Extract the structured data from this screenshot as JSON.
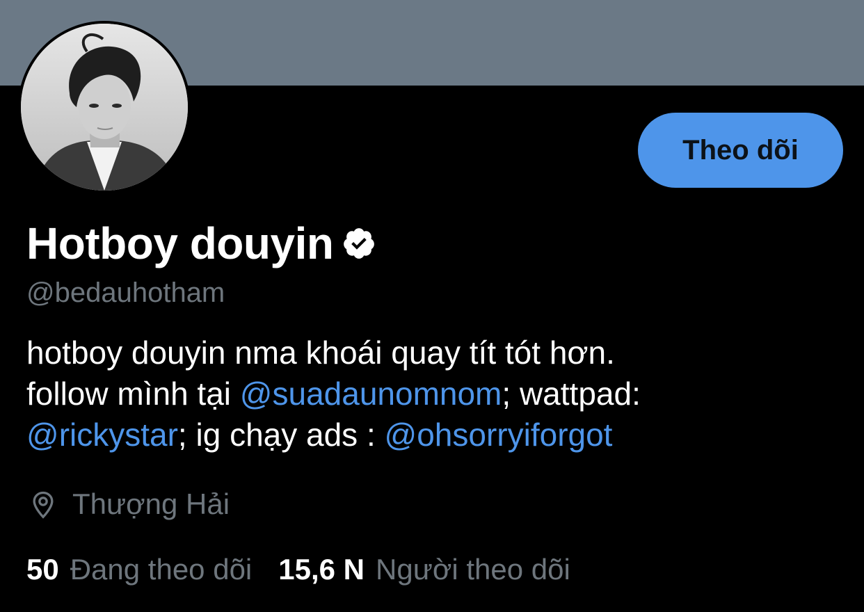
{
  "profile": {
    "display_name": "Hotboy douyin",
    "handle": "@bedauhotham",
    "verified_icon": "verified-badge-icon",
    "follow_button_label": "Theo dõi",
    "bio": {
      "line1": "hotboy douyin nma khoái quay tít tót hơn.",
      "line2_prefix": "follow mình tại ",
      "line2_mention": "@suadaunomnom",
      "line2_suffix": "; wattpad:",
      "line3_mention1": "@rickystar",
      "line3_middle": "; ig chạy ads : ",
      "line3_mention2": "@ohsorryiforgot"
    },
    "location": "Thượng Hải",
    "location_icon": "location-pin-icon",
    "following_count": "50",
    "following_label": "Đang theo dõi",
    "followers_count": "15,6 N",
    "followers_label": "Người theo dõi"
  },
  "colors": {
    "background": "#000000",
    "banner": "#6b7986",
    "accent": "#4e95ea",
    "secondary_text": "#6e767d",
    "primary_text": "#ffffff"
  }
}
